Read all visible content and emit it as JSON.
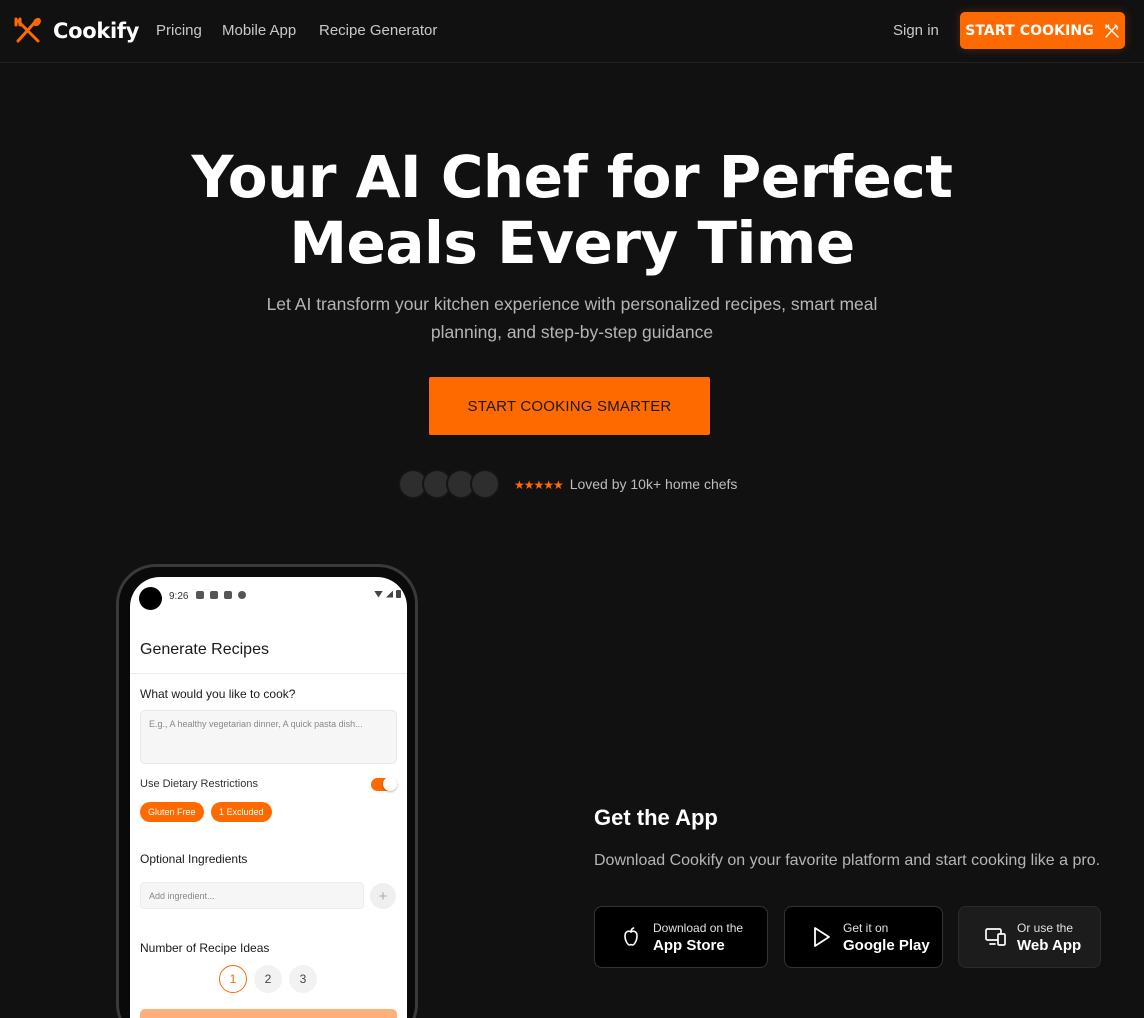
{
  "brand": {
    "name": "Cookify",
    "accent": "#ff6a00"
  },
  "nav": {
    "links": [
      "Pricing",
      "Mobile App",
      "Recipe Generator"
    ],
    "signin": "Sign in",
    "cta": "START COOKING"
  },
  "hero": {
    "title": "Your AI Chef for Perfect\nMeals Every Time",
    "subtitle": "Let AI transform your kitchen experience with personalized recipes, smart meal planning, and step-by-step guidance",
    "cta": "START COOKING SMARTER",
    "stars": "★★★★★",
    "proof": "Loved by 10k+ home chefs"
  },
  "phone": {
    "time": "9:26",
    "title": "Generate Recipes",
    "cook_label": "What would you like to cook?",
    "cook_placeholder": "E.g., A healthy vegetarian dinner, A quick pasta dish...",
    "dietary_label": "Use Dietary Restrictions",
    "dietary_enabled": true,
    "chips": [
      "Gluten Free",
      "1 Excluded"
    ],
    "ingredients_label": "Optional Ingredients",
    "ingredient_placeholder": "Add ingredient...",
    "add_symbol": "+",
    "ideas_label": "Number of Recipe Ideas",
    "ideas": [
      "1",
      "2",
      "3"
    ],
    "selected_idea": "1"
  },
  "get_app": {
    "title": "Get the App",
    "subtitle": "Download Cookify on your favorite platform and start cooking like a pro.",
    "app_store": {
      "small": "Download on the",
      "big": "App Store",
      "icon": "apple-icon"
    },
    "google_play": {
      "small": "Get it on",
      "big": "Google Play",
      "icon": "play-icon"
    },
    "web_app": {
      "small": "Or use the",
      "big": "Web App",
      "icon": "devices-icon"
    }
  }
}
